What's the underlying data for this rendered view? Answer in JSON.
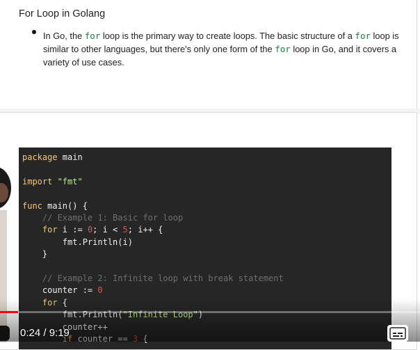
{
  "document": {
    "heading": "For Loop in Golang",
    "bullet": {
      "part1": "In Go, the ",
      "kw1": "for",
      "part2": " loop is the primary way to create loops. The basic structure of a ",
      "kw2": "for",
      "part3": " loop is similar to other languages, but there's only one form of the ",
      "kw3": "for",
      "part4": " loop in Go, and it covers a variety of use cases."
    }
  },
  "code": {
    "lines": [
      [
        {
          "t": "package",
          "c": "kw"
        },
        {
          "t": " main",
          "c": "def"
        }
      ],
      [],
      [
        {
          "t": "import",
          "c": "kw"
        },
        {
          "t": " \"fmt\"",
          "c": "str"
        }
      ],
      [],
      [
        {
          "t": "func",
          "c": "kw"
        },
        {
          "t": " main() {",
          "c": "def"
        }
      ],
      [
        {
          "t": "    // Example 1: Basic for loop",
          "c": "cmt"
        }
      ],
      [
        {
          "t": "    for",
          "c": "kw"
        },
        {
          "t": " i := ",
          "c": "def"
        },
        {
          "t": "0",
          "c": "num"
        },
        {
          "t": "; i < ",
          "c": "def"
        },
        {
          "t": "5",
          "c": "num"
        },
        {
          "t": "; i++ {",
          "c": "def"
        }
      ],
      [
        {
          "t": "        fmt.Println(i)",
          "c": "def"
        }
      ],
      [
        {
          "t": "    }",
          "c": "def"
        }
      ],
      [],
      [
        {
          "t": "    // Example 2: Infinite loop with break statement",
          "c": "cmt"
        }
      ],
      [
        {
          "t": "    counter := ",
          "c": "def"
        },
        {
          "t": "0",
          "c": "num"
        }
      ],
      [
        {
          "t": "    for",
          "c": "kw"
        },
        {
          "t": " {",
          "c": "def"
        }
      ],
      [
        {
          "t": "        fmt.Println(",
          "c": "def"
        },
        {
          "t": "\"Infinite Loop\"",
          "c": "str"
        },
        {
          "t": ")",
          "c": "def"
        }
      ],
      [
        {
          "t": "        counter++",
          "c": "def"
        }
      ],
      [
        {
          "t": "        if",
          "c": "kw"
        },
        {
          "t": " counter == ",
          "c": "def"
        },
        {
          "t": "3",
          "c": "num"
        },
        {
          "t": " {",
          "c": "def"
        }
      ]
    ]
  },
  "player": {
    "time": "0:24 / 9:19",
    "progress_fraction": 0.043,
    "accent": "#ff0000"
  }
}
